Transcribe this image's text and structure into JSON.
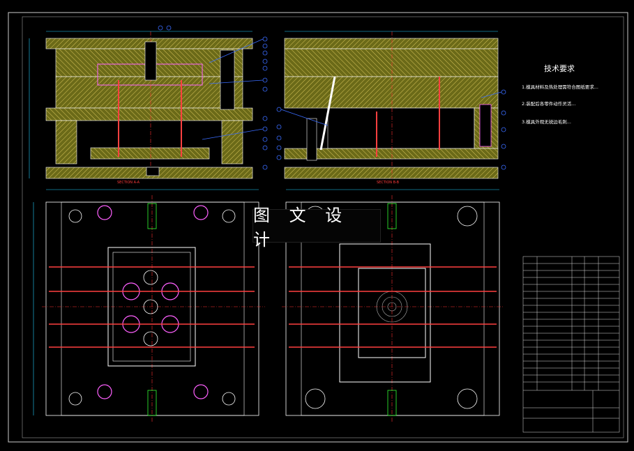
{
  "banner": {
    "text": "图 文 设 计"
  },
  "tech_requirements": {
    "title": "技术要求",
    "lines": [
      "1.模具材料及热处理需符合图纸要求...",
      "2.装配后各零件动作灵活...",
      "3.模具外观无锐边毛刺..."
    ]
  },
  "sections": {
    "left_label": "SECTION A-A",
    "right_label": "SECTION B-B"
  },
  "colors": {
    "background": "#000000",
    "plate_fill": "#6b6a18",
    "hatch": "#c8b64a",
    "outline": "#ffffff",
    "centerline": "#ff3030",
    "cooling": "#ff40ff",
    "callout": "#3a6cff",
    "dimension": "#20d0ff",
    "green": "#33ff33"
  }
}
